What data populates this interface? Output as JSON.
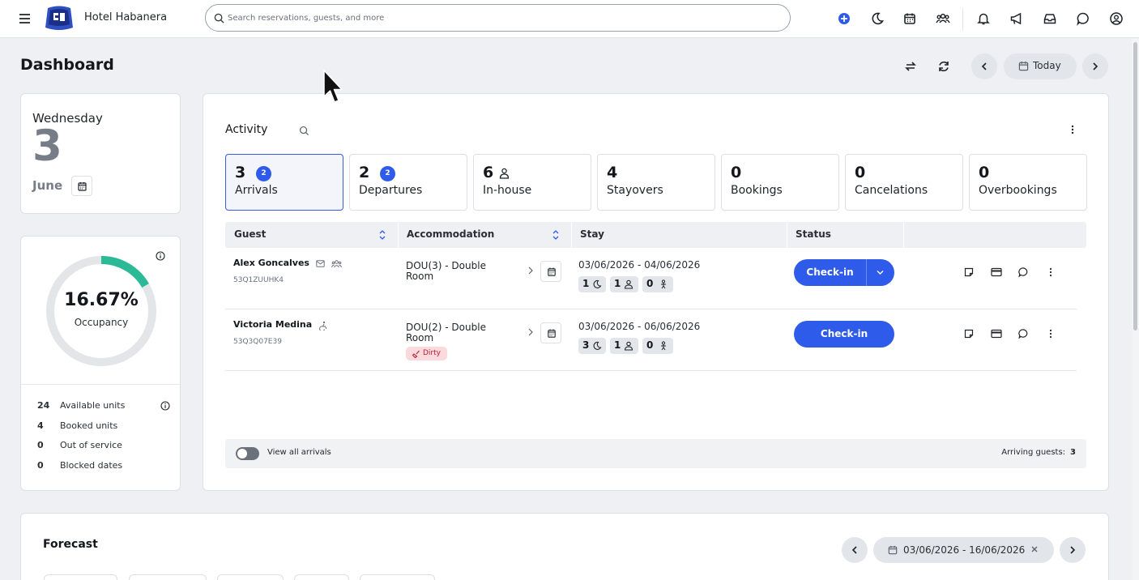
{
  "header": {
    "brand": "Hotel Habanera",
    "search_placeholder": "Search reservations, guests, and more",
    "icons": [
      "menu-icon",
      "add-icon",
      "moon-icon",
      "calendar-icon",
      "group-icon",
      "bell-icon",
      "megaphone-icon",
      "inbox-icon",
      "chat-icon",
      "account-icon"
    ]
  },
  "page": {
    "title": "Dashboard",
    "today_label": "Today"
  },
  "date_card": {
    "weekday": "Wednesday",
    "day": "3",
    "month": "June"
  },
  "occupancy": {
    "value": "16.67%",
    "label": "Occupancy",
    "fraction": 0.1667,
    "stats": [
      {
        "num": "24",
        "label": "Available units"
      },
      {
        "num": "4",
        "label": "Booked units"
      },
      {
        "num": "0",
        "label": "Out of service"
      },
      {
        "num": "0",
        "label": "Blocked dates"
      }
    ]
  },
  "activity": {
    "title": "Activity",
    "tabs": [
      {
        "num": "3",
        "badge": "2",
        "label": "Arrivals"
      },
      {
        "num": "2",
        "badge": "2",
        "label": "Departures"
      },
      {
        "num": "6",
        "label": "In-house"
      },
      {
        "num": "4",
        "label": "Stayovers"
      },
      {
        "num": "0",
        "label": "Bookings"
      },
      {
        "num": "0",
        "label": "Cancelations"
      },
      {
        "num": "0",
        "label": "Overbookings"
      }
    ],
    "columns": [
      "Guest",
      "Accommodation",
      "Stay",
      "Status"
    ],
    "rows": [
      {
        "guest": "Alex Goncalves",
        "code": "53Q1ZUUHK4",
        "acc1": "DOU(3) - Double",
        "acc2": "Room",
        "dates": "03/06/2026 - 04/06/2026",
        "nights": "1",
        "adults": "1",
        "children": "0",
        "status": "Check-in"
      },
      {
        "guest": "Victoria Medina",
        "code": "53Q3Q07E39",
        "acc1": "DOU(2) - Double",
        "acc2": "Room",
        "tag": "Dirty",
        "dates": "03/06/2026 - 06/06/2026",
        "nights": "3",
        "adults": "1",
        "children": "0",
        "status": "Check-in"
      }
    ],
    "footer": {
      "toggle_label": "View all arrivals",
      "arriving_label": "Arriving guests:",
      "arriving_count": "3"
    }
  },
  "forecast": {
    "title": "Forecast",
    "range": "03/06/2026 - 16/06/2026"
  },
  "colors": {
    "primary": "#2f5bea",
    "occupancy_fill": "#2bb996",
    "occupancy_track": "#e3e5e9",
    "dirty_bg": "#fbd9dd"
  }
}
